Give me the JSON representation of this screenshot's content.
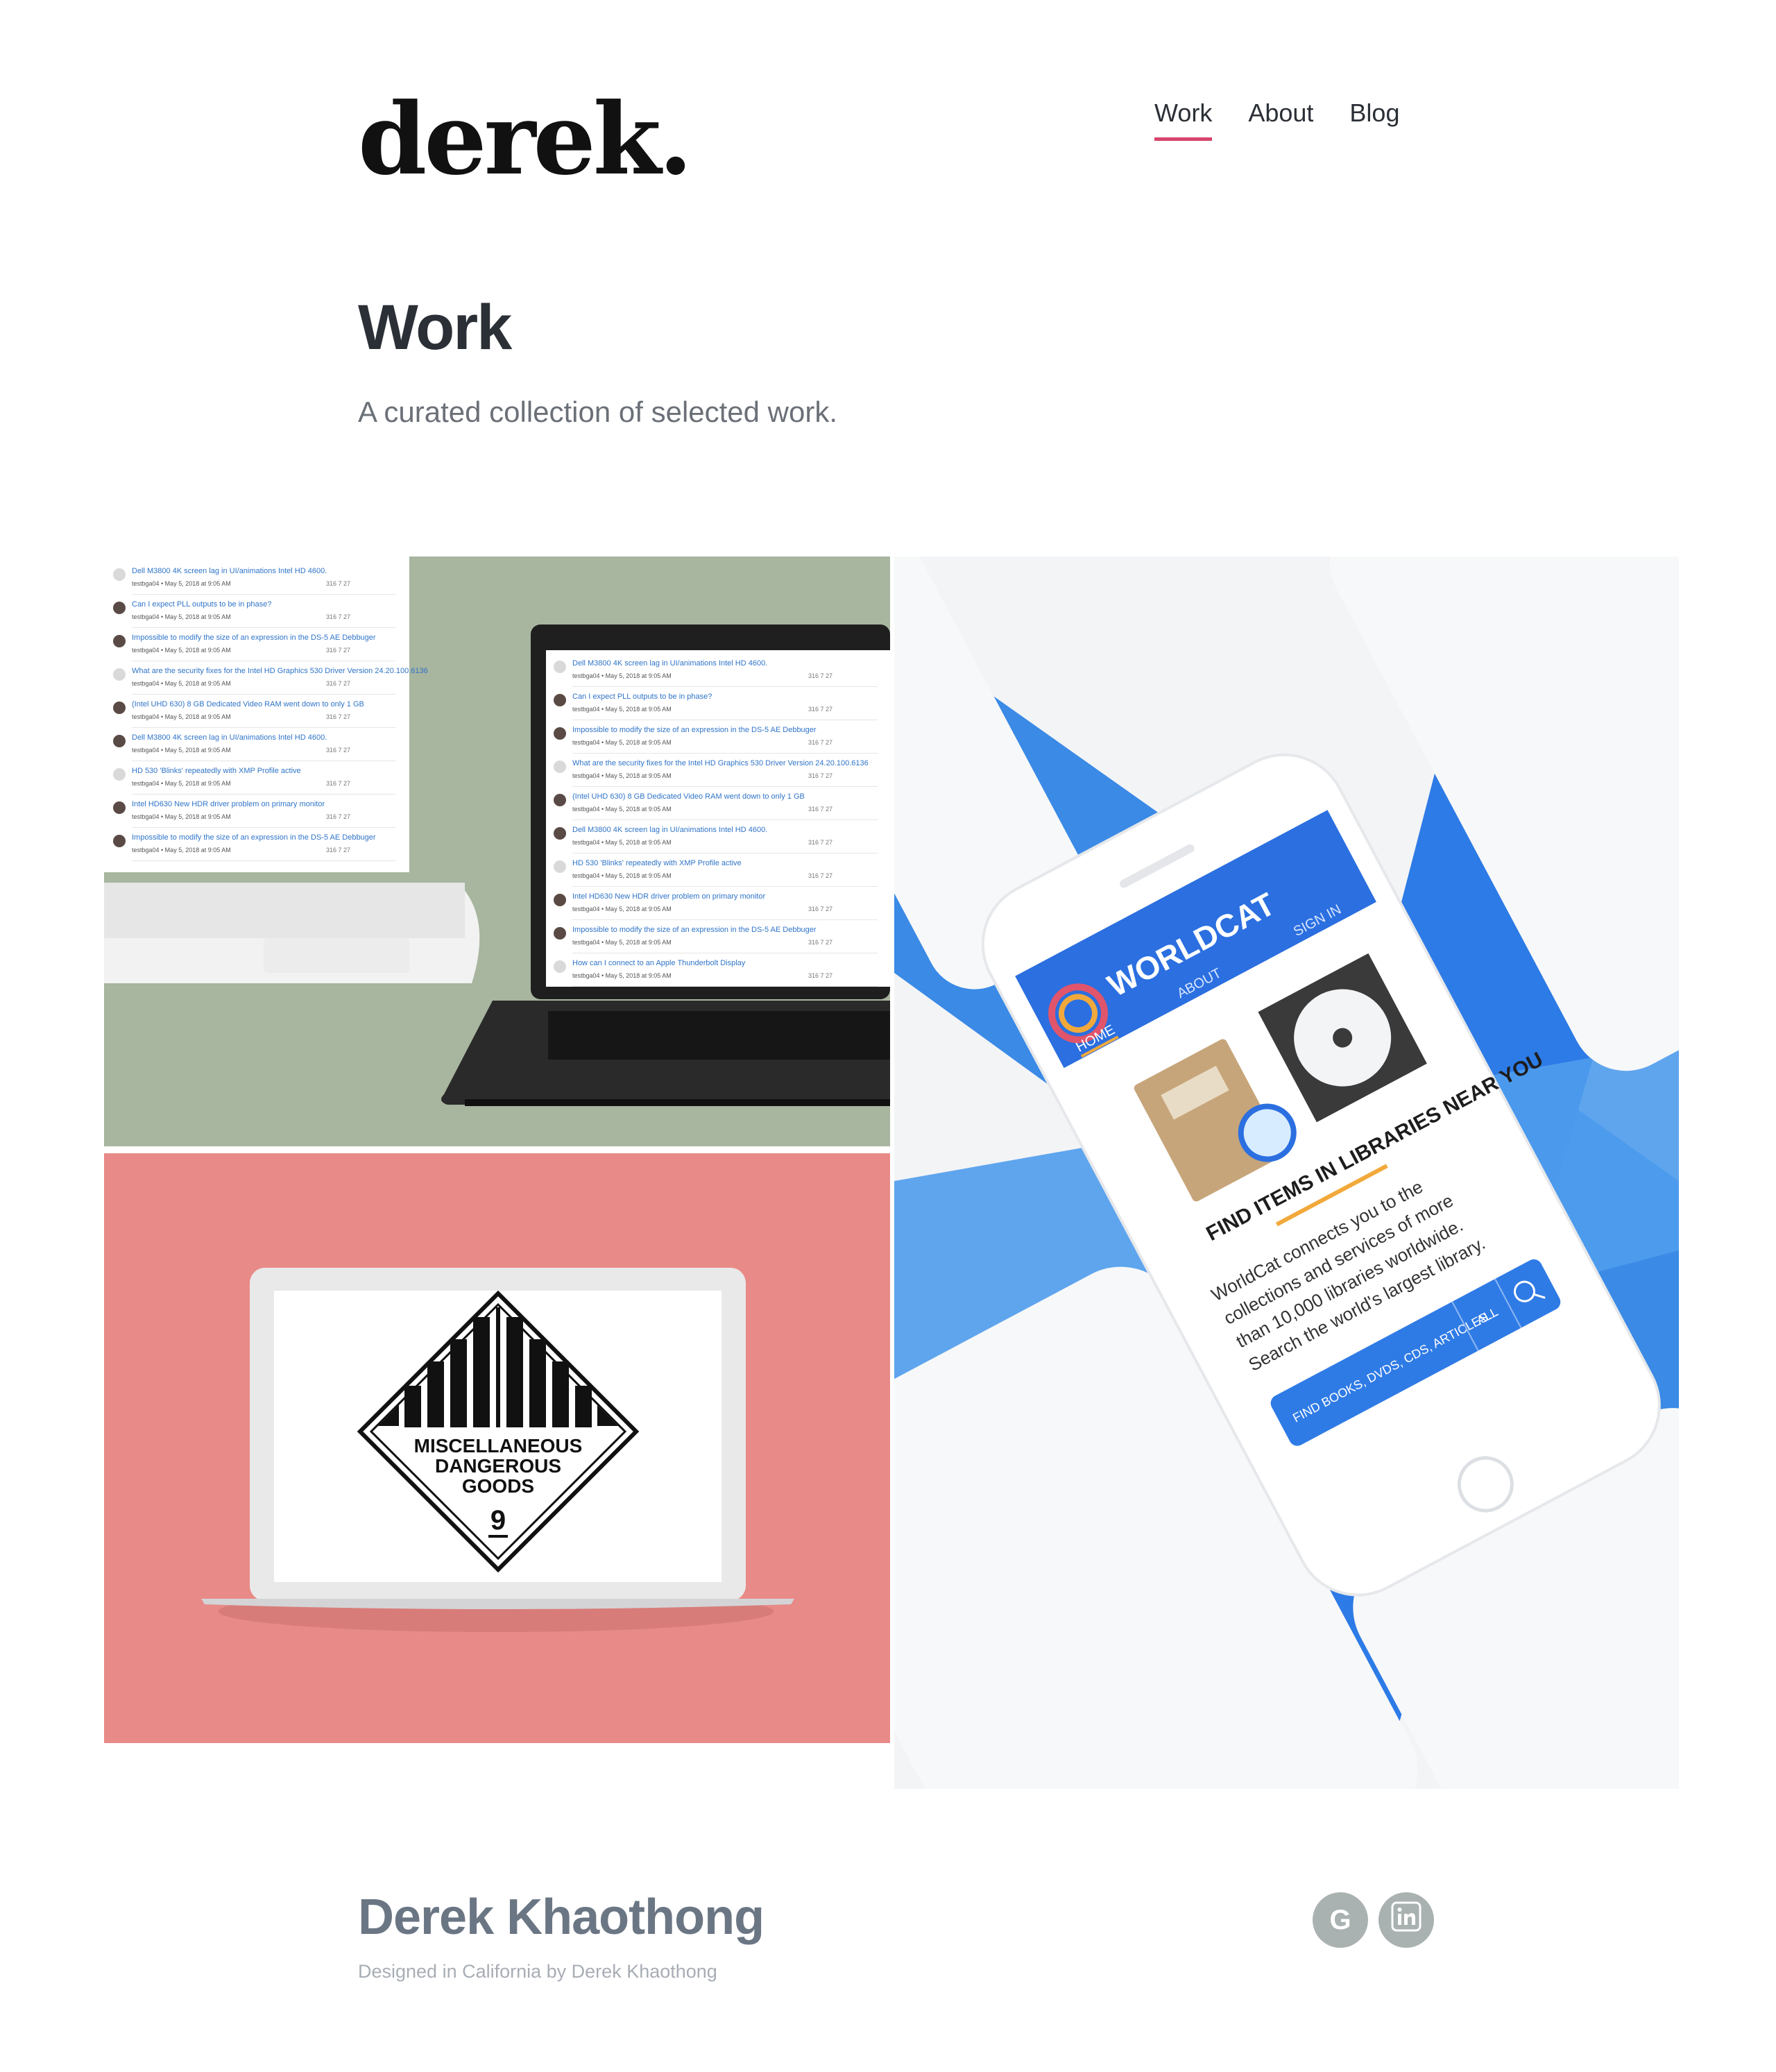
{
  "header": {
    "logo": "derek.",
    "nav": [
      {
        "label": "Work",
        "active": true
      },
      {
        "label": "About",
        "active": false
      },
      {
        "label": "Blog",
        "active": false
      }
    ]
  },
  "main": {
    "title": "Work",
    "subtitle": "A curated collection of selected work."
  },
  "projects": [
    {
      "thread_titles": [
        "Dell M3800 4K screen lag in UI/animations Intel HD 4600.",
        "Can I expect PLL outputs to be in phase?",
        "Impossible to modify the size of an expression in the DS-5 AE Debbuger",
        "What are the security fixes for the Intel HD Graphics 530 Driver Version 24.20.100.6136",
        "(Intel UHD 630) 8 GB Dedicated Video RAM went down to only 1 GB",
        "Dell M3800 4K screen lag in UI/animations Intel HD 4600.",
        "HD 530 'Blinks' repeatedly with XMP Profile active",
        "Intel HD630 New HDR driver problem on primary monitor",
        "Impossible to modify the size of an expression in the DS-5 AE Debbuger",
        "How can I connect to an Apple Thunderbolt Display"
      ],
      "thread_meta": "testbga04 • May 5, 2018 at 9:05 AM",
      "thread_stats": [
        "316",
        "7",
        "27"
      ]
    },
    {
      "placard_lines": [
        "MISCELLANEOUS",
        "DANGEROUS",
        "GOODS"
      ],
      "placard_number": "9"
    },
    {
      "app_name": "WORLDCAT",
      "nav": [
        "HOME",
        "ABOUT",
        "SIGN IN"
      ],
      "headline": "FIND ITEMS IN LIBRARIES NEAR YOU",
      "body_lines": [
        "WorldCat connects you to the",
        "collections and services of more",
        "than 10,000 libraries worldwide.",
        "Search the world's largest library."
      ],
      "search_placeholder": "FIND BOOKS, DVDS, CDS, ARTICLES...",
      "search_filter": "ALL"
    }
  ],
  "footer": {
    "name": "Derek Khaothong",
    "credit": "Designed in California by Derek Khaothong",
    "social": [
      {
        "icon": "google-icon",
        "label": "G"
      },
      {
        "icon": "linkedin-icon",
        "label": "in"
      }
    ]
  },
  "colors": {
    "accent": "#d6456b",
    "sage": "#a8b59f",
    "coral": "#e88a87",
    "worldcat_blue": "#2d7be6",
    "social_gray": "#a9b2b0"
  }
}
